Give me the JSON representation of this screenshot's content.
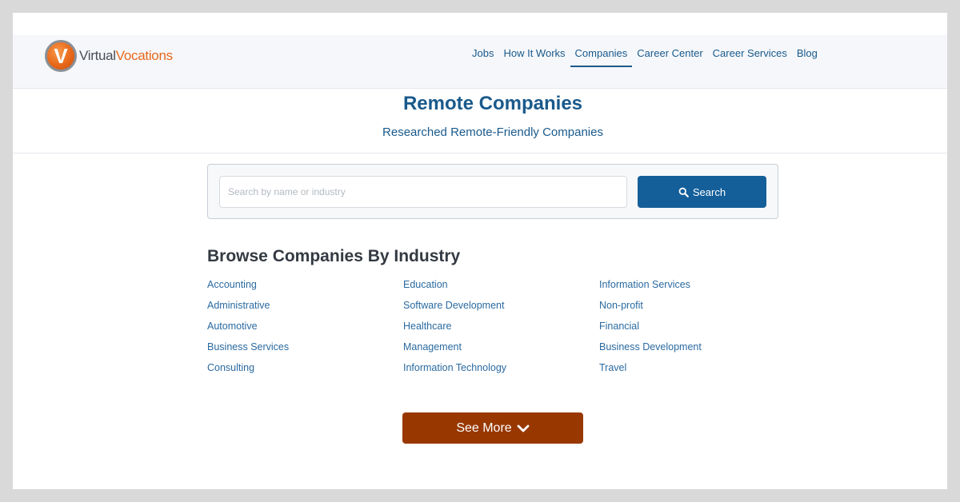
{
  "brand": {
    "mark": "V",
    "name_part1": "Virtual",
    "name_part2": "Vocations",
    "colors": {
      "orange": "#e8681a",
      "gray": "#4a4f57"
    }
  },
  "nav": {
    "items": [
      {
        "label": "Jobs",
        "active": false
      },
      {
        "label": "How It Works",
        "active": false
      },
      {
        "label": "Companies",
        "active": true
      },
      {
        "label": "Career Center",
        "active": false
      },
      {
        "label": "Career Services",
        "active": false
      },
      {
        "label": "Blog",
        "active": false
      }
    ]
  },
  "hero": {
    "title": "Remote Companies",
    "subtitle": "Researched Remote-Friendly Companies"
  },
  "search": {
    "value": "",
    "placeholder": "Search by name or industry",
    "button_label": "Search",
    "button_icon": "search-icon",
    "button_color": "#145f9a"
  },
  "browse": {
    "title": "Browse Companies By Industry",
    "industries": [
      "Accounting",
      "Education",
      "Information Services",
      "Administrative",
      "Software Development",
      "Non-profit",
      "Automotive",
      "Healthcare",
      "Financial",
      "Business Services",
      "Management",
      "Business Development",
      "Consulting",
      "Information Technology",
      "Travel"
    ]
  },
  "see_more": {
    "label": "See More",
    "icon": "chevron-down-icon",
    "color": "#983800"
  }
}
